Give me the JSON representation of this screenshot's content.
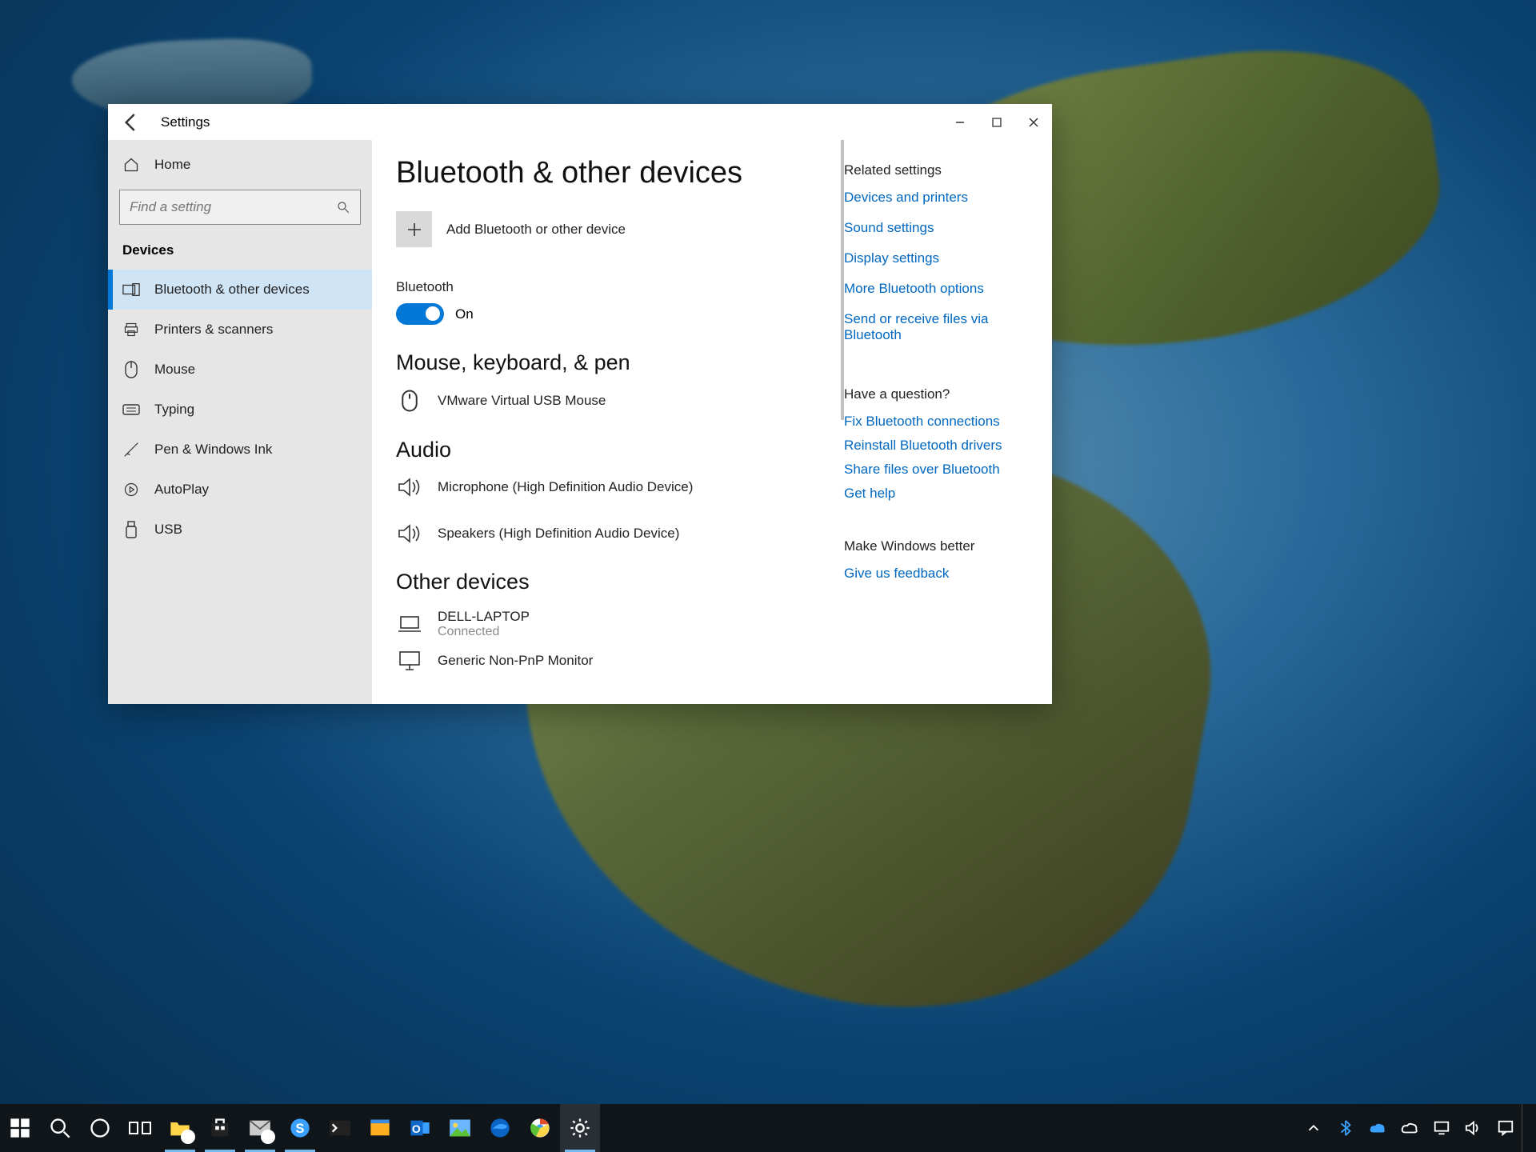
{
  "window": {
    "title": "Settings",
    "sidebar": {
      "home": "Home",
      "search_placeholder": "Find a setting",
      "category": "Devices",
      "items": [
        {
          "label": "Bluetooth & other devices",
          "icon": "devices-icon",
          "active": true
        },
        {
          "label": "Printers & scanners",
          "icon": "printer-icon"
        },
        {
          "label": "Mouse",
          "icon": "mouse-icon"
        },
        {
          "label": "Typing",
          "icon": "keyboard-icon"
        },
        {
          "label": "Pen & Windows Ink",
          "icon": "pen-icon"
        },
        {
          "label": "AutoPlay",
          "icon": "autoplay-icon"
        },
        {
          "label": "USB",
          "icon": "usb-icon"
        }
      ]
    },
    "page": {
      "title": "Bluetooth & other devices",
      "add_device": "Add Bluetooth or other device",
      "bluetooth": {
        "heading": "Bluetooth",
        "state_label": "On",
        "on": true
      },
      "sections": [
        {
          "title": "Mouse, keyboard, & pen",
          "devices": [
            {
              "name": "VMware Virtual USB Mouse",
              "icon": "mouse-outline-icon"
            }
          ]
        },
        {
          "title": "Audio",
          "devices": [
            {
              "name": "Microphone (High Definition Audio Device)",
              "icon": "speaker-icon"
            },
            {
              "name": "Speakers (High Definition Audio Device)",
              "icon": "speaker-icon"
            }
          ]
        },
        {
          "title": "Other devices",
          "devices": [
            {
              "name": "DELL-LAPTOP",
              "sub": "Connected",
              "icon": "laptop-icon"
            },
            {
              "name": "Generic Non-PnP Monitor",
              "icon": "monitor-icon"
            }
          ]
        }
      ]
    },
    "right": {
      "related_title": "Related settings",
      "related": [
        "Devices and printers",
        "Sound settings",
        "Display settings",
        "More Bluetooth options",
        "Send or receive files via Bluetooth"
      ],
      "question_title": "Have a question?",
      "question": [
        "Fix Bluetooth connections",
        "Reinstall Bluetooth drivers",
        "Share files over Bluetooth",
        "Get help"
      ],
      "better_title": "Make Windows better",
      "better": [
        "Give us feedback"
      ]
    }
  },
  "taskbar": {
    "left": [
      {
        "name": "start-button",
        "icon": "windows-icon"
      },
      {
        "name": "search-button",
        "icon": "search-icon"
      },
      {
        "name": "cortana-button",
        "icon": "cortana-circle-icon"
      },
      {
        "name": "task-view-button",
        "icon": "taskview-icon"
      },
      {
        "name": "file-explorer-button",
        "icon": "folder-icon",
        "open": true,
        "badge": true
      },
      {
        "name": "microsoft-store-button",
        "icon": "store-icon",
        "open": true
      },
      {
        "name": "mail-button",
        "icon": "mail-icon",
        "open": true,
        "badge": true
      },
      {
        "name": "skype-button",
        "icon": "skype-icon",
        "open": true
      },
      {
        "name": "terminal-button",
        "icon": "terminal-icon"
      },
      {
        "name": "movies-button",
        "icon": "movies-icon"
      },
      {
        "name": "outlook-button",
        "icon": "outlook-icon"
      },
      {
        "name": "photos-button",
        "icon": "photos-icon"
      },
      {
        "name": "edge-button",
        "icon": "edge-icon"
      },
      {
        "name": "chrome-button",
        "icon": "chrome-icon"
      },
      {
        "name": "settings-button",
        "icon": "gear-icon",
        "active": true
      }
    ],
    "tray": [
      {
        "name": "overflow-tray",
        "icon": "chevron-up-icon"
      },
      {
        "name": "bluetooth-tray",
        "icon": "bluetooth-icon"
      },
      {
        "name": "onedrive-tray",
        "icon": "cloud-icon"
      },
      {
        "name": "weather-tray",
        "icon": "cloud-outline-icon"
      },
      {
        "name": "network-tray",
        "icon": "monitor-small-icon"
      },
      {
        "name": "volume-tray",
        "icon": "volume-icon"
      },
      {
        "name": "action-center-tray",
        "icon": "notification-icon",
        "badge": true
      }
    ]
  }
}
